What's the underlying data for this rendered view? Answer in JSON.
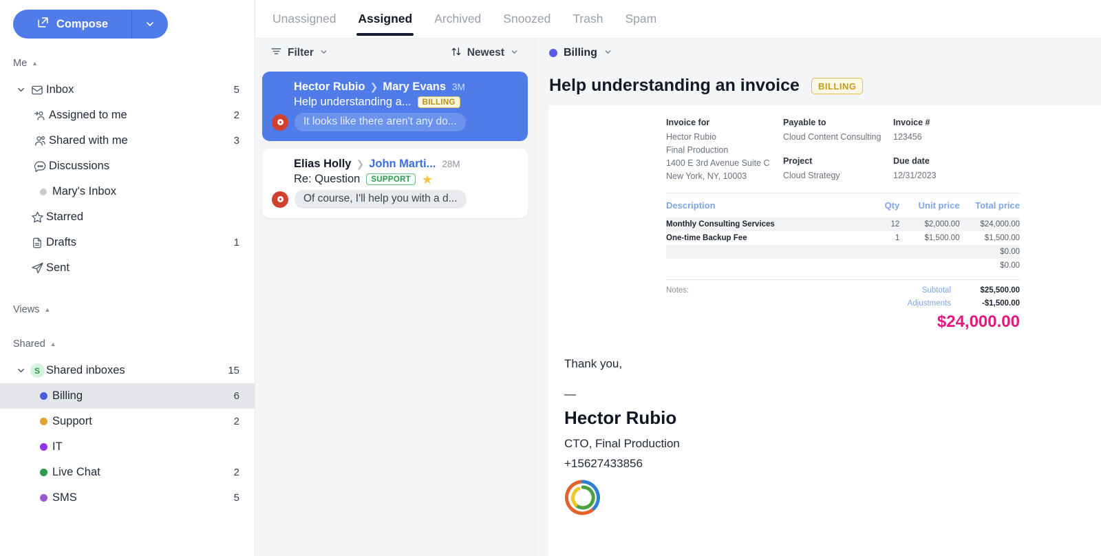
{
  "sidebar": {
    "compose": {
      "label": "Compose",
      "icon": "compose-pencil-icon",
      "caret": "chevron-down-icon"
    },
    "sections": [
      {
        "title": "Me",
        "collapse_icon": "triangle-up-icon"
      },
      {
        "title": "Views",
        "collapse_icon": "triangle-up-icon"
      },
      {
        "title": "Shared",
        "collapse_icon": "triangle-up-icon"
      }
    ],
    "me_items": [
      {
        "label": "Inbox",
        "count": "5",
        "icon": "inbox-icon",
        "expand": "chevron-down-icon"
      },
      {
        "label": "Assigned to me",
        "count": "2",
        "icon": "assigned-person-icon"
      },
      {
        "label": "Shared with me",
        "count": "3",
        "icon": "people-icon"
      },
      {
        "label": "Discussions",
        "count": "",
        "icon": "chat-bubble-icon"
      },
      {
        "label": "Mary's Inbox",
        "count": "",
        "icon": "gray-dot-icon"
      },
      {
        "label": "Starred",
        "count": "",
        "icon": "star-outline-icon"
      },
      {
        "label": "Drafts",
        "count": "1",
        "icon": "document-icon"
      },
      {
        "label": "Sent",
        "count": "",
        "icon": "paper-plane-icon"
      }
    ],
    "shared_root": {
      "label": "Shared inboxes",
      "count": "15",
      "badge": "S",
      "expand": "chevron-down-icon"
    },
    "shared_items": [
      {
        "label": "Billing",
        "count": "6",
        "color": "#4c5ce0",
        "selected": true
      },
      {
        "label": "Support",
        "count": "2",
        "color": "#e0a32e",
        "selected": false
      },
      {
        "label": "IT",
        "count": "",
        "color": "#9333ea",
        "selected": false
      },
      {
        "label": "Live Chat",
        "count": "2",
        "color": "#2d9c4a",
        "selected": false
      },
      {
        "label": "SMS",
        "count": "5",
        "color": "#9b59d0",
        "selected": false
      }
    ]
  },
  "tabs": [
    {
      "label": "Unassigned",
      "active": false
    },
    {
      "label": "Assigned",
      "active": true
    },
    {
      "label": "Archived",
      "active": false
    },
    {
      "label": "Snoozed",
      "active": false
    },
    {
      "label": "Trash",
      "active": false
    },
    {
      "label": "Spam",
      "active": false
    }
  ],
  "list_toolbar": {
    "filter_label": "Filter",
    "filter_icon": "filter-lines-icon",
    "sort_label": "Newest",
    "sort_icon": "sort-arrows-icon",
    "caret": "chevron-down-icon"
  },
  "conversations": [
    {
      "from": "Hector Rubio",
      "to": "Mary Evans",
      "time": "3M",
      "subject": "Help understanding a...",
      "tag": "BILLING",
      "tag_kind": "billing",
      "starred": false,
      "avatar": "O",
      "snippet": "It looks like there aren't any do...",
      "selected": true
    },
    {
      "from": "Elias Holly",
      "to": "John Marti...",
      "time": "28M",
      "subject": "Re: Question",
      "tag": "SUPPORT",
      "tag_kind": "support",
      "starred": true,
      "avatar": "O",
      "snippet": "Of course, I'll help you with a d...",
      "selected": false
    }
  ],
  "reader": {
    "inbox_chip": {
      "label": "Billing",
      "color": "#5a5ce0",
      "caret": "chevron-down-icon"
    },
    "subject": "Help understanding an invoice",
    "subject_tag": "BILLING"
  },
  "invoice": {
    "invoice_for_label": "Invoice for",
    "invoice_for_lines": [
      "Hector Rubio",
      "Final Production",
      "1400 E 3rd Avenue Suite C",
      "New York, NY, 10003"
    ],
    "payable_to_label": "Payable to",
    "payable_to_value": "Cloud Content Consulting",
    "invoice_num_label": "Invoice #",
    "invoice_num_value": "123456",
    "project_label": "Project",
    "project_value": "Cloud Strategy",
    "due_date_label": "Due date",
    "due_date_value": "12/31/2023",
    "columns": [
      "Description",
      "Qty",
      "Unit price",
      "Total price"
    ],
    "rows": [
      {
        "description": "Monthly Consulting Services",
        "qty": "12",
        "unit_price": "$2,000.00",
        "total_price": "$24,000.00",
        "shaded": true,
        "highlighted": false
      },
      {
        "description": "One-time Backup Fee",
        "qty": "1",
        "unit_price": "$1,500.00",
        "total_price": "$1,500.00",
        "shaded": false,
        "highlighted": true
      },
      {
        "description": "",
        "qty": "",
        "unit_price": "",
        "total_price": "$0.00",
        "shaded": true,
        "highlighted": false
      },
      {
        "description": "",
        "qty": "",
        "unit_price": "",
        "total_price": "$0.00",
        "shaded": false,
        "highlighted": false
      }
    ],
    "notes_label": "Notes:",
    "subtotal_label": "Subtotal",
    "subtotal_value": "$25,500.00",
    "adjustments_label": "Adjustments",
    "adjustments_value": "-$1,500.00",
    "grand_total": "$24,000.00"
  },
  "signature": {
    "thanks": "Thank you,",
    "dash": "—",
    "name": "Hector Rubio",
    "title": "CTO, Final Production",
    "phone": "+15627433856",
    "logo_icon": "company-swirl-logo"
  }
}
